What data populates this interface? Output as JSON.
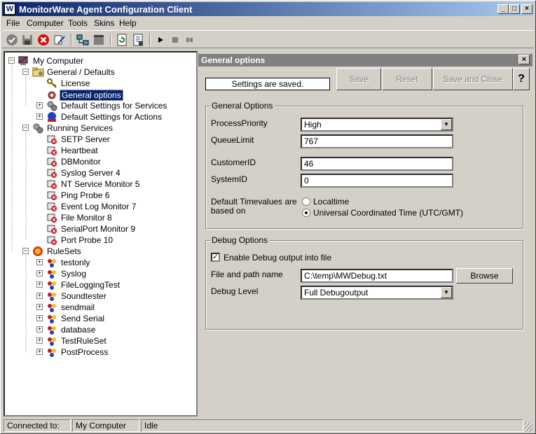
{
  "window": {
    "title": "MonitorWare Agent Configuration Client",
    "controls": [
      "_",
      "□",
      "×"
    ]
  },
  "menu": [
    "File",
    "Computer",
    "Tools",
    "Skins",
    "Help"
  ],
  "toolbar": [
    "check-icon",
    "save-icon",
    "stop-icon",
    "wizard-icon",
    "network-icon",
    "window-icon",
    "refresh-icon",
    "settings-icon",
    "play-icon",
    "stop-square-icon",
    "pause-icon"
  ],
  "tree": {
    "root": "My Computer",
    "general": {
      "label": "General / Defaults",
      "children": [
        {
          "label": "License"
        },
        {
          "label": "General options",
          "selected": true
        },
        {
          "label": "Default Settings for Services"
        },
        {
          "label": "Default Settings for Actions"
        }
      ]
    },
    "services": {
      "label": "Running Services",
      "children": [
        "SETP Server",
        "Heartbeat",
        "DBMonitor",
        "Syslog Server 4",
        "NT Service Monitor 5",
        "Ping Probe 6",
        "Event Log Monitor 7",
        "File Monitor 8",
        "SerialPort Monitor 9",
        "Port Probe 10"
      ]
    },
    "rulesets": {
      "label": "RuleSets",
      "children": [
        "testonly",
        "Syslog",
        "FileLoggingTest",
        "Soundtester",
        "sendmail",
        "Send Serial",
        "database",
        "TestRuleSet",
        "PostProcess"
      ]
    }
  },
  "panel": {
    "title": "General options",
    "close": "×",
    "status": "Settings are saved.",
    "buttons": {
      "save": "Save",
      "reset": "Reset",
      "save_close": "Save and Close",
      "help": "?"
    },
    "general_group": {
      "title": "General Options",
      "process_priority_label": "ProcessPriority",
      "process_priority_value": "High",
      "queue_limit_label": "QueueLimit",
      "queue_limit_value": "767",
      "customer_id_label": "CustomerID",
      "customer_id_value": "46",
      "system_id_label": "SystemID",
      "system_id_value": "0",
      "timevalues_label_1": "Default Timevalues are",
      "timevalues_label_2": "based on",
      "radio_localtime": "Localtime",
      "radio_utc": "Universal Coordinated Time (UTC/GMT)",
      "selected_timevalue": "utc"
    },
    "debug_group": {
      "title": "Debug Options",
      "enable_label": "Enable Debug output into file",
      "enabled": true,
      "file_label": "File and path name",
      "file_value": "C:\\temp\\MWDebug.txt",
      "browse": "Browse",
      "level_label": "Debug Level",
      "level_value": "Full Debugoutput"
    }
  },
  "statusbar": {
    "connected_label": "Connected to:",
    "computer": "My Computer",
    "state": "Idle"
  }
}
